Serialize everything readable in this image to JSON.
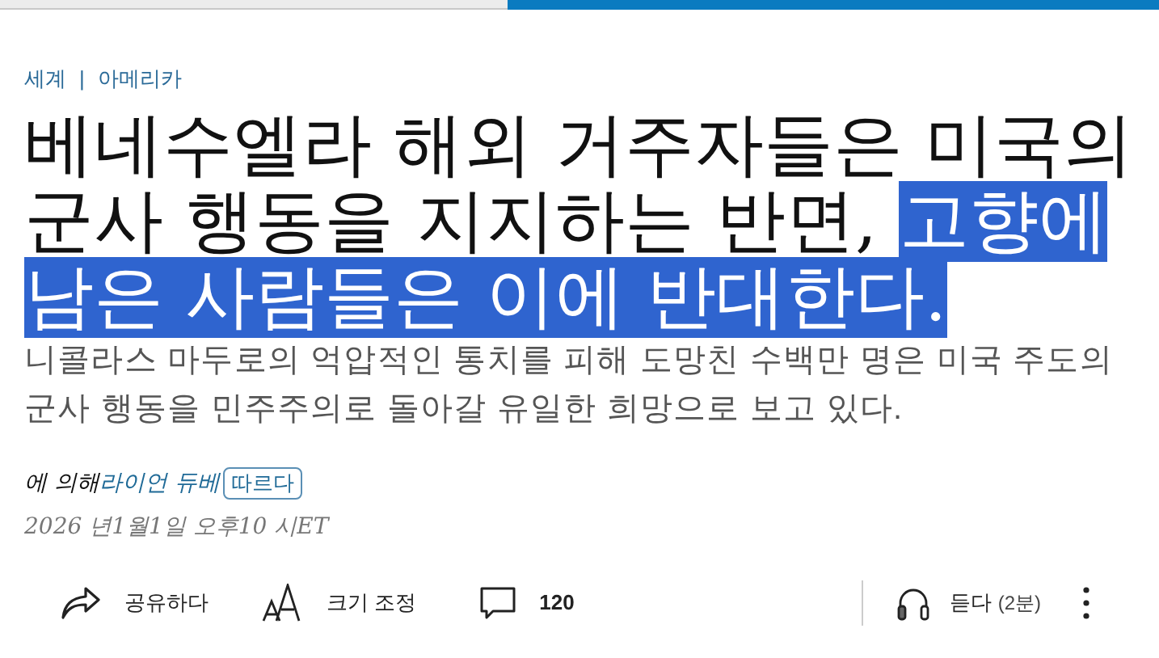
{
  "breadcrumbs": [
    {
      "label": "세계"
    },
    {
      "label": "아메리카"
    }
  ],
  "breadcrumb_separator": "|",
  "headline": {
    "text": "베네수엘라 해외 거주자들은 미국의 군사 행동을 지지하는 반면, ",
    "selected_text": "고향에 남은 사람들은 이에 반대한다."
  },
  "summary": "니콜라스 마두로의 억압적인 통치를 피해 도망친 수백만 명은 미국 주도의 군사 행동을 민주주의로 돌아갈 유일한 희망으로 보고 있다.",
  "byline": {
    "prefix": "에 의해",
    "author": "라이언 듀베",
    "follow_button": "따르다"
  },
  "date": "2026 년1월1일 오후10 시ET",
  "actions": [
    {
      "kind": "share",
      "label": "공유하다"
    },
    {
      "kind": "resize",
      "label": "크기 조정"
    },
    {
      "kind": "comments",
      "label": "120"
    }
  ],
  "listen": {
    "label": "듣다",
    "duration": "(2분)"
  }
}
